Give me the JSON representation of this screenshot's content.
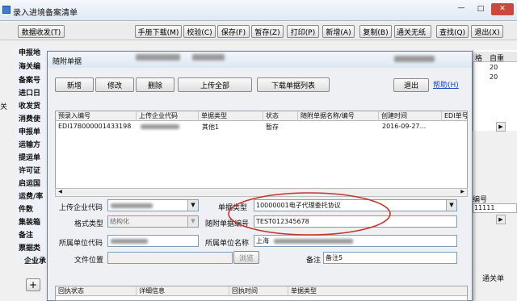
{
  "main_window": {
    "title": "录入进境备案清单",
    "controls": [
      "—",
      "□",
      "✕"
    ],
    "toolbar_left": "数据收发(T)",
    "toolbar": [
      "手册下载(M)",
      "校验(C)",
      "保存(F)",
      "暂存(Z)",
      "打印(P)",
      "新增(A)",
      "复制(B)",
      "通关无纸",
      "查找(Q)",
      "退出(X)"
    ],
    "left_labels": [
      "申报地",
      "海关编",
      "备案号",
      "进口日",
      "收发货",
      "消费使",
      "申报单",
      "运输方",
      "提运单",
      "许可证",
      "启运国",
      "运费/率",
      "件数",
      "集装箱",
      "备注",
      "票据类",
      "企业承"
    ],
    "right_headers": [
      "格",
      "自重"
    ],
    "right_values": [
      "20",
      "20"
    ],
    "right_text_1": "编号",
    "right_text_2": "11111",
    "right_text_3": "通关单",
    "plus": "+"
  },
  "dialog": {
    "title": "随附单据",
    "buttons": [
      "新增",
      "修改",
      "删除",
      "上传全部",
      "下载单据列表"
    ],
    "exit_button": "退出",
    "help_link": "帮助(H)",
    "grid": {
      "headers": [
        "预录入编号",
        "上传企业代码",
        "单据类型",
        "状态",
        "随附单据名称/编号",
        "创建时间",
        "EDI单号"
      ],
      "rows": [
        [
          "EDI17B000001433198",
          "",
          "其他1",
          "暂存",
          "",
          "2016-09-27...",
          ""
        ]
      ]
    },
    "form": {
      "upload_company_label": "上传企业代码",
      "doc_type_label": "单据类型",
      "doc_type_value": "10000001电子代理委托协议",
      "format_type_label": "格式类型",
      "format_type_value": "结构化",
      "doc_number_label": "随附单据编号",
      "doc_number_value": "TEST012345678",
      "owner_code_label": "所属单位代码",
      "owner_name_label": "所属单位名称",
      "owner_name_value": "上海",
      "file_location_label": "文件位置",
      "browse_button": "浏览",
      "remark_label": "备注",
      "remark_value": "备注5"
    },
    "bottom_grid": {
      "headers": [
        "回执状态",
        "详细信息",
        "回执时间",
        "单据类型"
      ]
    }
  }
}
